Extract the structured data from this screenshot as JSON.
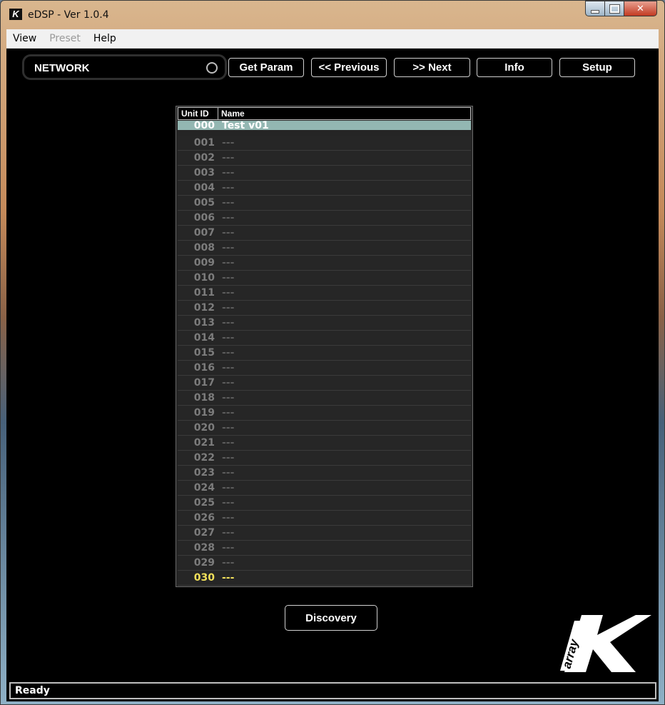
{
  "window": {
    "title": "eDSP - Ver 1.0.4",
    "app_icon": "k-array-logo-icon",
    "controls": [
      "minimize-icon",
      "maximize-icon",
      "close-icon"
    ]
  },
  "menu": {
    "items": [
      {
        "label": "View",
        "enabled": true
      },
      {
        "label": "Preset",
        "enabled": false
      },
      {
        "label": "Help",
        "enabled": true
      }
    ]
  },
  "toolbar": {
    "network_label": "NETWORK",
    "get_param": "Get Param",
    "previous": "<< Previous",
    "next": ">> Next",
    "info": "Info",
    "setup": "Setup"
  },
  "unit_table": {
    "headers": {
      "id": "Unit ID",
      "name": "Name"
    },
    "rows": [
      {
        "id": "000",
        "name": "Test v01",
        "state": "selected"
      },
      {
        "id": "001",
        "name": "---"
      },
      {
        "id": "002",
        "name": "---"
      },
      {
        "id": "003",
        "name": "---"
      },
      {
        "id": "004",
        "name": "---"
      },
      {
        "id": "005",
        "name": "---"
      },
      {
        "id": "006",
        "name": "---"
      },
      {
        "id": "007",
        "name": "---"
      },
      {
        "id": "008",
        "name": "---"
      },
      {
        "id": "009",
        "name": "---"
      },
      {
        "id": "010",
        "name": "---"
      },
      {
        "id": "011",
        "name": "---"
      },
      {
        "id": "012",
        "name": "---"
      },
      {
        "id": "013",
        "name": "---"
      },
      {
        "id": "014",
        "name": "---"
      },
      {
        "id": "015",
        "name": "---"
      },
      {
        "id": "016",
        "name": "---"
      },
      {
        "id": "017",
        "name": "---"
      },
      {
        "id": "018",
        "name": "---"
      },
      {
        "id": "019",
        "name": "---"
      },
      {
        "id": "020",
        "name": "---"
      },
      {
        "id": "021",
        "name": "---"
      },
      {
        "id": "022",
        "name": "---"
      },
      {
        "id": "023",
        "name": "---"
      },
      {
        "id": "024",
        "name": "---"
      },
      {
        "id": "025",
        "name": "---"
      },
      {
        "id": "026",
        "name": "---"
      },
      {
        "id": "027",
        "name": "---"
      },
      {
        "id": "028",
        "name": "---"
      },
      {
        "id": "029",
        "name": "---"
      },
      {
        "id": "030",
        "name": "---",
        "state": "highlight"
      }
    ]
  },
  "discovery_label": "Discovery",
  "brand": {
    "logo_text": "array",
    "logo_letter": "K"
  },
  "status": "Ready",
  "colors": {
    "selected_row": "#93b7b2",
    "highlight_row_text": "#f1e05a",
    "background": "#000000"
  }
}
